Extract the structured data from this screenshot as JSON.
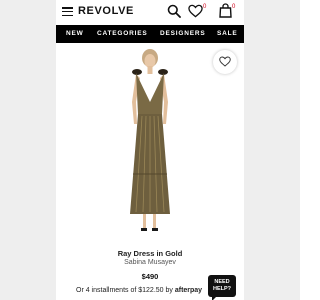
{
  "header": {
    "brand": "REVOLVE",
    "wishlist_count": "0",
    "bag_count": "0"
  },
  "nav": {
    "items": [
      "NEW",
      "CATEGORIES",
      "DESIGNERS",
      "SALE"
    ]
  },
  "product": {
    "name": "Ray Dress in Gold",
    "designer": "Sabina Musayev",
    "price": "$490",
    "installments_text": "Or 4 installments of $122.50 by",
    "installments_provider": "afterpay"
  },
  "help": {
    "label_line1": "NEED",
    "label_line2": "HELP?"
  },
  "colors": {
    "accent": "#d0021b",
    "nav_bg": "#000000",
    "dress_gold": "#7a6a45"
  }
}
